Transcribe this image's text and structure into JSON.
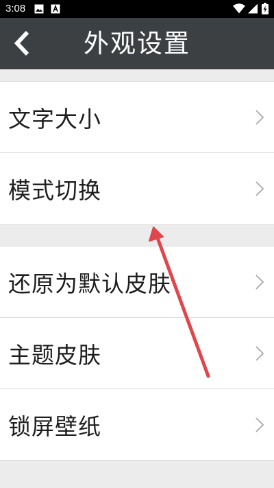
{
  "status_bar": {
    "time": "3:08",
    "icons": [
      "image-icon",
      "a-badge-icon",
      "wifi-icon",
      "signal-icon",
      "battery-charging-icon"
    ]
  },
  "header": {
    "title": "外观设置",
    "back_icon": "chevron-left-icon"
  },
  "groups": [
    {
      "items": [
        {
          "label": "文字大小"
        },
        {
          "label": "模式切换"
        }
      ]
    },
    {
      "items": [
        {
          "label": "还原为默认皮肤"
        },
        {
          "label": "主题皮肤"
        },
        {
          "label": "锁屏壁纸"
        }
      ]
    }
  ],
  "colors": {
    "app_bar": "#3c4043",
    "background": "#ececec",
    "annotation_arrow": "#e0474c"
  }
}
